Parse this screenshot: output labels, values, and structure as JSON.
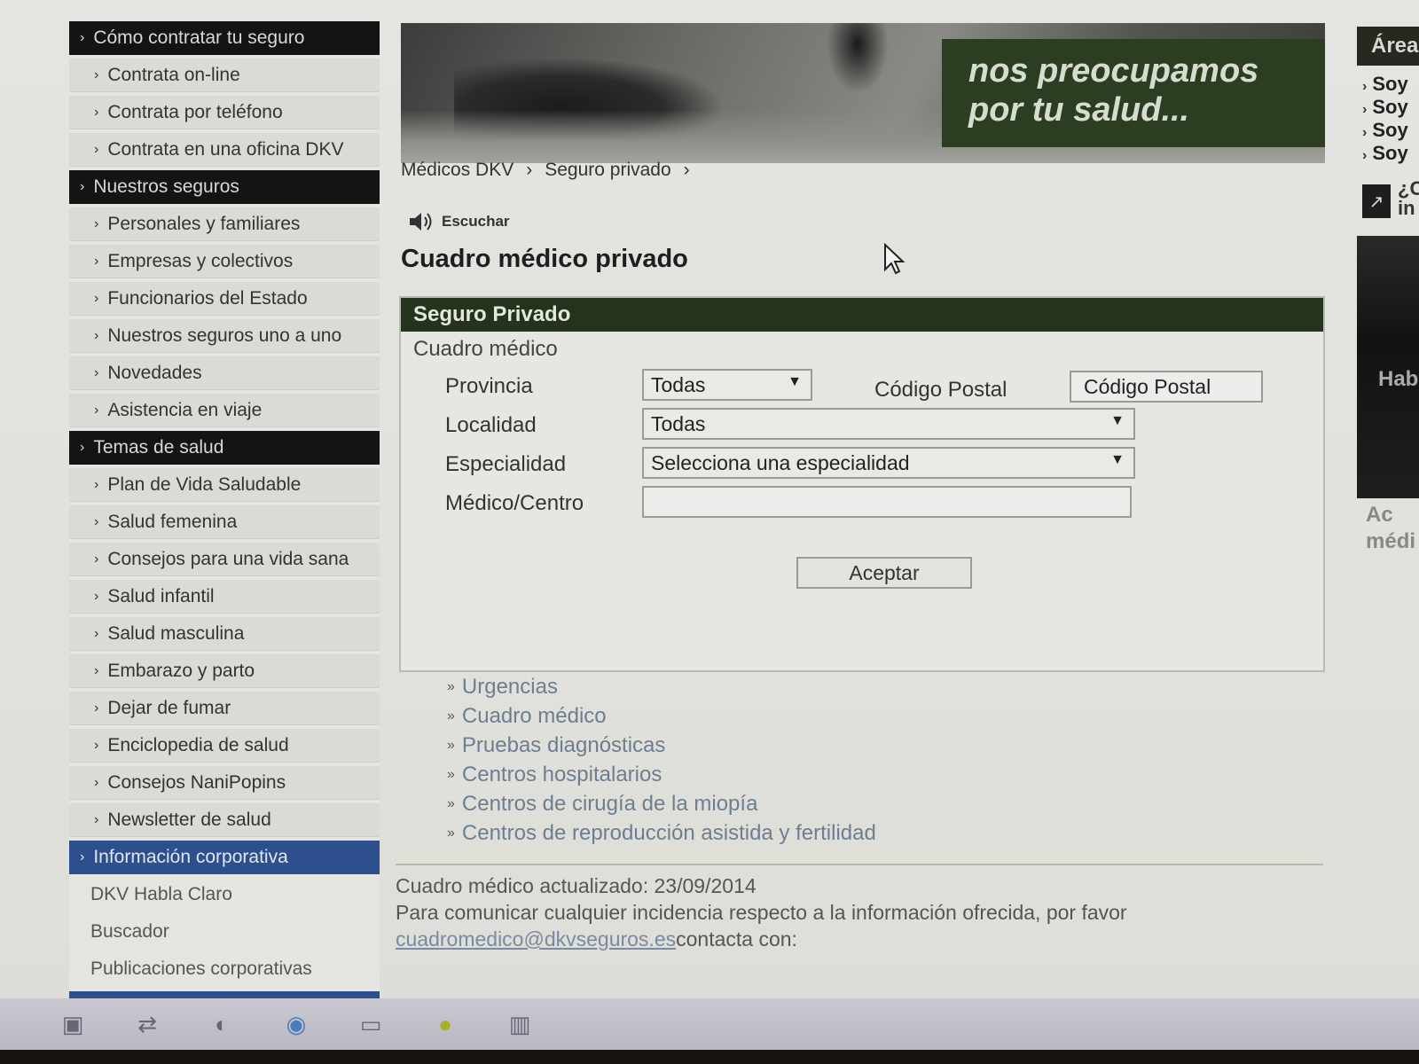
{
  "sidebar": {
    "groups": [
      {
        "header": "Cómo contratar tu seguro",
        "items": [
          "Contrata on-line",
          "Contrata por teléfono",
          "Contrata en una oficina DKV"
        ]
      },
      {
        "header": "Nuestros seguros",
        "items": [
          "Personales y familiares",
          "Empresas y colectivos",
          "Funcionarios del Estado",
          "Nuestros seguros uno a uno",
          "Novedades",
          "Asistencia en viaje"
        ]
      },
      {
        "header": "Temas de salud",
        "items": [
          "Plan de Vida Saludable",
          "Salud femenina",
          "Consejos para una vida sana",
          "Salud infantil",
          "Salud masculina",
          "Embarazo y parto",
          "Dejar de fumar",
          "Enciclopedia de salud",
          "Consejos NaniPopins",
          "Newsletter de salud"
        ]
      },
      {
        "header": "Información corporativa",
        "items": [
          "DKV Habla Claro",
          "Buscador",
          "Publicaciones corporativas"
        ]
      }
    ]
  },
  "banner": {
    "slogan_line1": "nos preocupamos",
    "slogan_line2": "por tu salud..."
  },
  "breadcrumb": [
    "Médicos DKV",
    "Seguro privado"
  ],
  "listen_label": "Escuchar",
  "page_title": "Cuadro médico privado",
  "form": {
    "header": "Seguro Privado",
    "subheader": "Cuadro médico",
    "provincia_label": "Provincia",
    "provincia_value": "Todas",
    "postal_label": "Código Postal",
    "postal_placeholder": "Código Postal",
    "localidad_label": "Localidad",
    "localidad_value": "Todas",
    "especialidad_label": "Especialidad",
    "especialidad_value": "Selecciona una especialidad",
    "medico_label": "Médico/Centro",
    "medico_value": "",
    "submit_label": "Aceptar"
  },
  "links": [
    "Urgencias",
    "Cuadro médico",
    "Pruebas diagnósticas",
    "Centros hospitalarios",
    "Centros de cirugía de la miopía",
    "Centros de reproducción asistida y fertilidad"
  ],
  "footer": {
    "updated": "Cuadro médico actualizado: 23/09/2014",
    "notice": "Para comunicar cualquier incidencia respecto a la información ofrecida, por favor",
    "email": "cuadromedico@dkvseguros.es",
    "contact": "contacta con:"
  },
  "right_col": {
    "area_head": "Área",
    "area_items": [
      "Soy",
      "Soy",
      "Soy",
      "Soy"
    ],
    "question_line1": "¿C",
    "question_line2": "in",
    "dark_text": "Hab",
    "foot_line1": "Ac",
    "foot_line2": "médi"
  },
  "icons": {
    "chevron": "chevron-right-icon",
    "speaker": "speaker-icon",
    "dropdown": "dropdown-arrow-icon",
    "link_bullet": "double-chevron-icon",
    "external": "external-link-icon"
  },
  "colors": {
    "nav_section_bg": "#141414",
    "nav_active_bg": "#2e4f8e",
    "panel_header_bg": "#25331c",
    "link_color": "#6d7e90"
  }
}
